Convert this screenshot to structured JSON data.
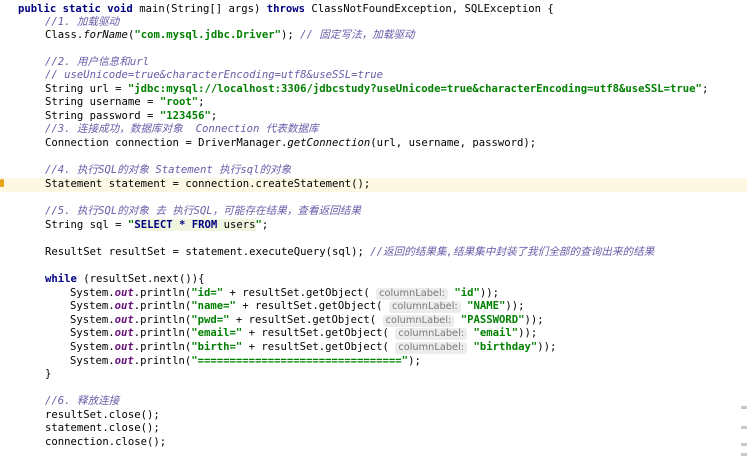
{
  "lines": {
    "main_decl": {
      "pre": "public static void ",
      "name": "main(String[] args) ",
      "throws": "throws ",
      "rest": "ClassNotFoundException, SQLException {"
    },
    "c1": "//1. 加载驱动",
    "load_driver": {
      "a": "Class.",
      "b": "forName",
      "c": "(",
      "d": "\"com.mysql.jdbc.Driver\"",
      "e": "); ",
      "f": "// 固定写法，加载驱动"
    },
    "c2": "//2. 用户信息和url",
    "c2b": "// useUnicode=true&characterEncoding=utf8&useSSL=true",
    "url": {
      "a": "String url = ",
      "b": "\"jdbc:mysql://localhost:3306/jdbcstudy?useUnicode=true&characterEncoding=utf8&useSSL=true\"",
      "c": ";"
    },
    "username": {
      "a": "String username = ",
      "b": "\"root\"",
      "c": ";"
    },
    "password": {
      "a": "String password = ",
      "b": "\"123456\"",
      "c": ";"
    },
    "c3": "//3. 连接成功，数据库对象  Connection 代表数据库",
    "conn": {
      "a": "Connection connection = DriverManager.",
      "b": "getConnection",
      "c": "(url, username, password);"
    },
    "c4": "//4. 执行SQL的对象 Statement 执行sql的对象",
    "stmt": "Statement statement = connection.createStatement();",
    "c5": "//5. 执行SQL的对象 去 执行SQL，可能存在结果，查看返回结果",
    "sql": {
      "a": "String sql = ",
      "b": "\"",
      "c": "SELECT * FROM ",
      "d": "users",
      "e": "\"",
      "f": ";"
    },
    "rs": {
      "a": "ResultSet resultSet = statement.executeQuery(sql); ",
      "b": "//返回的结果集,结果集中封装了我们全部的查询出来的结果"
    },
    "while": {
      "a": "while",
      "b": " (resultSet.next()){"
    },
    "println": {
      "sys": "System.",
      "out": "out",
      "call": ".println(",
      "rows": [
        {
          "s": "\"id=\"",
          "mid": " + resultSet.getObject( ",
          "hint": "columnLabel:",
          "arg": "\"id\"",
          "end": "));"
        },
        {
          "s": "\"name=\"",
          "mid": " + resultSet.getObject( ",
          "hint": "columnLabel:",
          "arg": "\"NAME\"",
          "end": "));"
        },
        {
          "s": "\"pwd=\"",
          "mid": " + resultSet.getObject( ",
          "hint": "columnLabel:",
          "arg": "\"PASSWORD\"",
          "end": "));"
        },
        {
          "s": "\"email=\"",
          "mid": " + resultSet.getObject( ",
          "hint": "columnLabel:",
          "arg": "\"email\"",
          "end": "));"
        },
        {
          "s": "\"birth=\"",
          "mid": " + resultSet.getObject( ",
          "hint": "columnLabel:",
          "arg": "\"birthday\"",
          "end": "));"
        }
      ],
      "sep": "\"================================\"",
      "sep_end": ");"
    },
    "close_brace": "}",
    "c6": "//6. 释放连接",
    "rs_close": "resultSet.close();",
    "st_close": "statement.close();",
    "conn_close": "connection.close();"
  }
}
